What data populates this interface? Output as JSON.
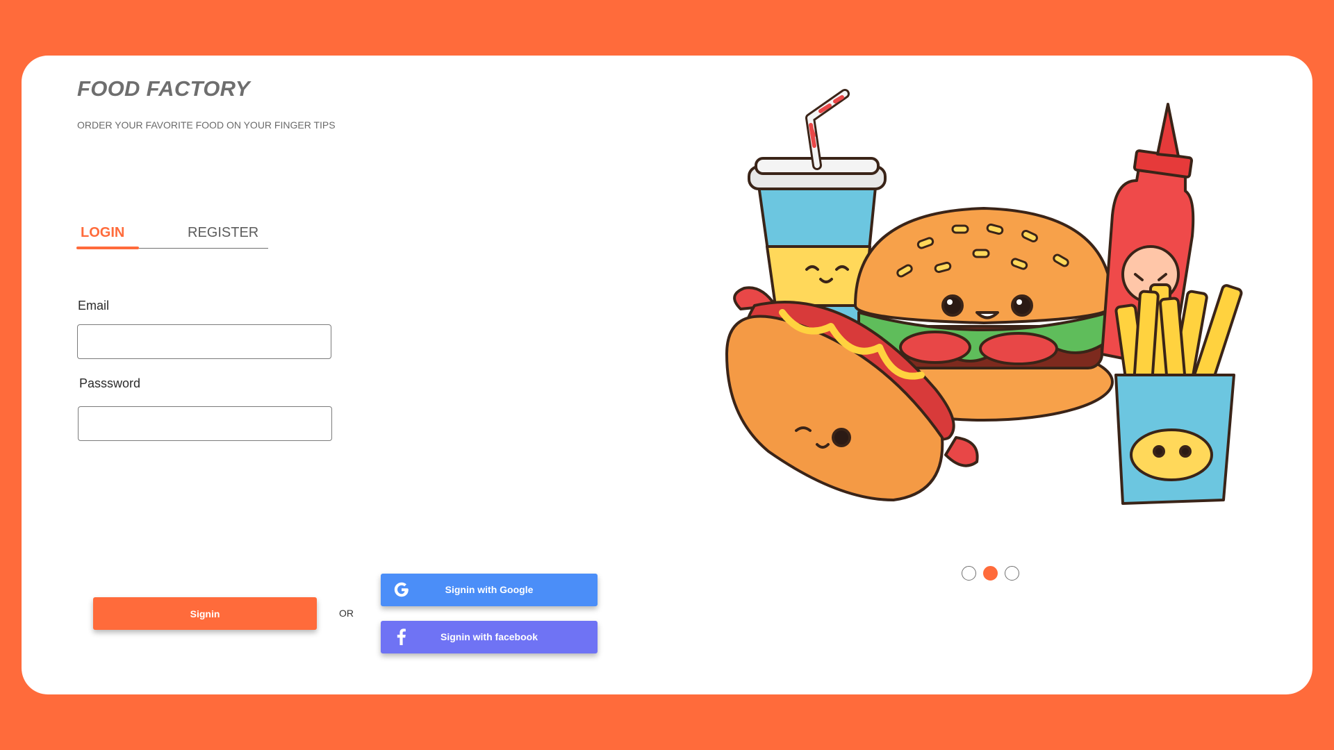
{
  "brand": {
    "title": "FOOD FACTORY",
    "tagline": "ORDER YOUR FAVORITE FOOD ON YOUR FINGER TIPS"
  },
  "tabs": {
    "login": "LOGIN",
    "register": "REGISTER",
    "active": "login"
  },
  "form": {
    "email_label": "Email",
    "email_value": "",
    "password_label": "Passsword",
    "password_value": ""
  },
  "actions": {
    "signin_label": "Signin",
    "or_text": "OR",
    "google_label": "Signin  with Google",
    "facebook_label": "Signin  with facebook"
  },
  "carousel": {
    "slide_count": 3,
    "active_index": 2
  },
  "colors": {
    "accent": "#ff6b3b",
    "google": "#4b8ef8",
    "facebook": "#6f73f4"
  },
  "icons": {
    "google": "google-icon",
    "facebook": "facebook-icon"
  }
}
